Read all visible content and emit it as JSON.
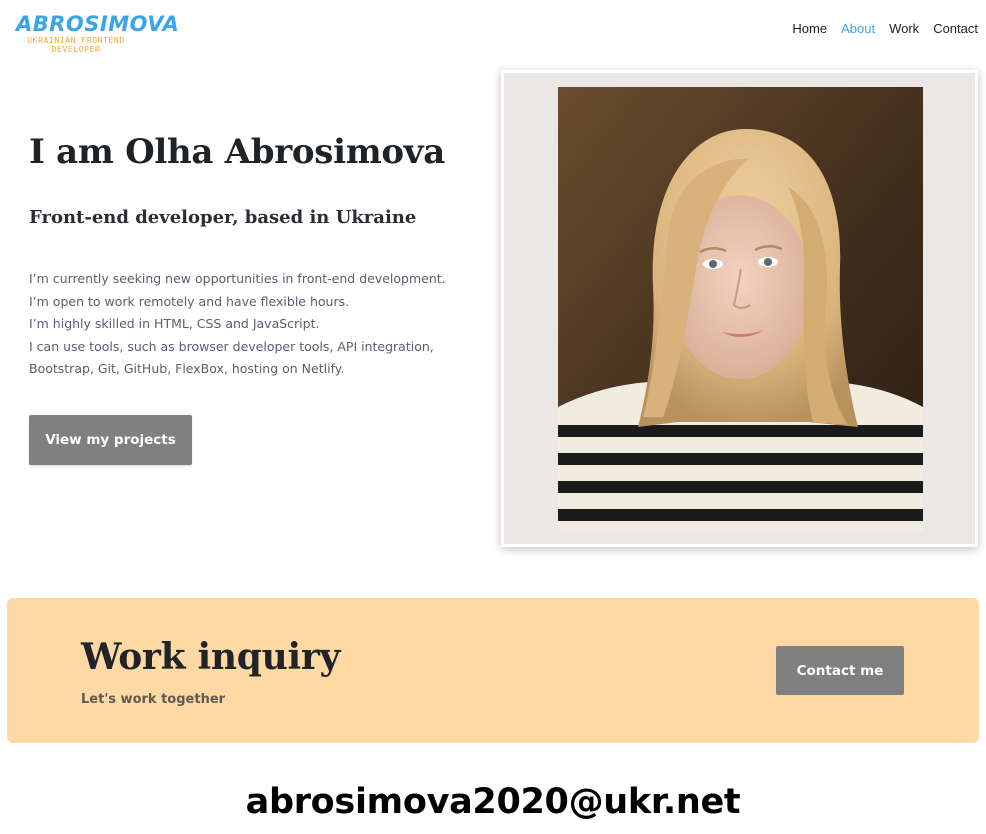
{
  "header": {
    "logo_title": "ABROSIMOVA",
    "logo_subtitle_line1": "UKRAINIAN FRONTEND",
    "logo_subtitle_line2": "DEVELOPER",
    "nav": [
      {
        "label": "Home",
        "active": false
      },
      {
        "label": "About",
        "active": true
      },
      {
        "label": "Work",
        "active": false
      },
      {
        "label": "Contact",
        "active": false
      }
    ]
  },
  "hero": {
    "title": "I am Olha Abrosimova",
    "subtitle": "Front-end developer, based in Ukraine",
    "lines": [
      "I’m currently seeking new opportunities in front-end development.",
      "I’m open to work remotely and have flexible hours.",
      "I’m highly skilled in HTML, CSS and JavaScript.",
      "I can use tools, such as browser developer tools, API integration,",
      "Bootstrap, Git, GitHub, FlexBox, hosting on Netlify."
    ],
    "button_label": "View my projects"
  },
  "inquiry": {
    "title": "Work inquiry",
    "subtitle": "Let's work together",
    "button_label": "Contact me"
  },
  "email": "abrosimova2020@ukr.net",
  "colors": {
    "accent": "#3aa4e8",
    "logo_subtitle": "#f0a830",
    "button_bg": "#808080",
    "inquiry_bg": "#fed9a4",
    "photo_card_bg": "#ece7e7"
  }
}
